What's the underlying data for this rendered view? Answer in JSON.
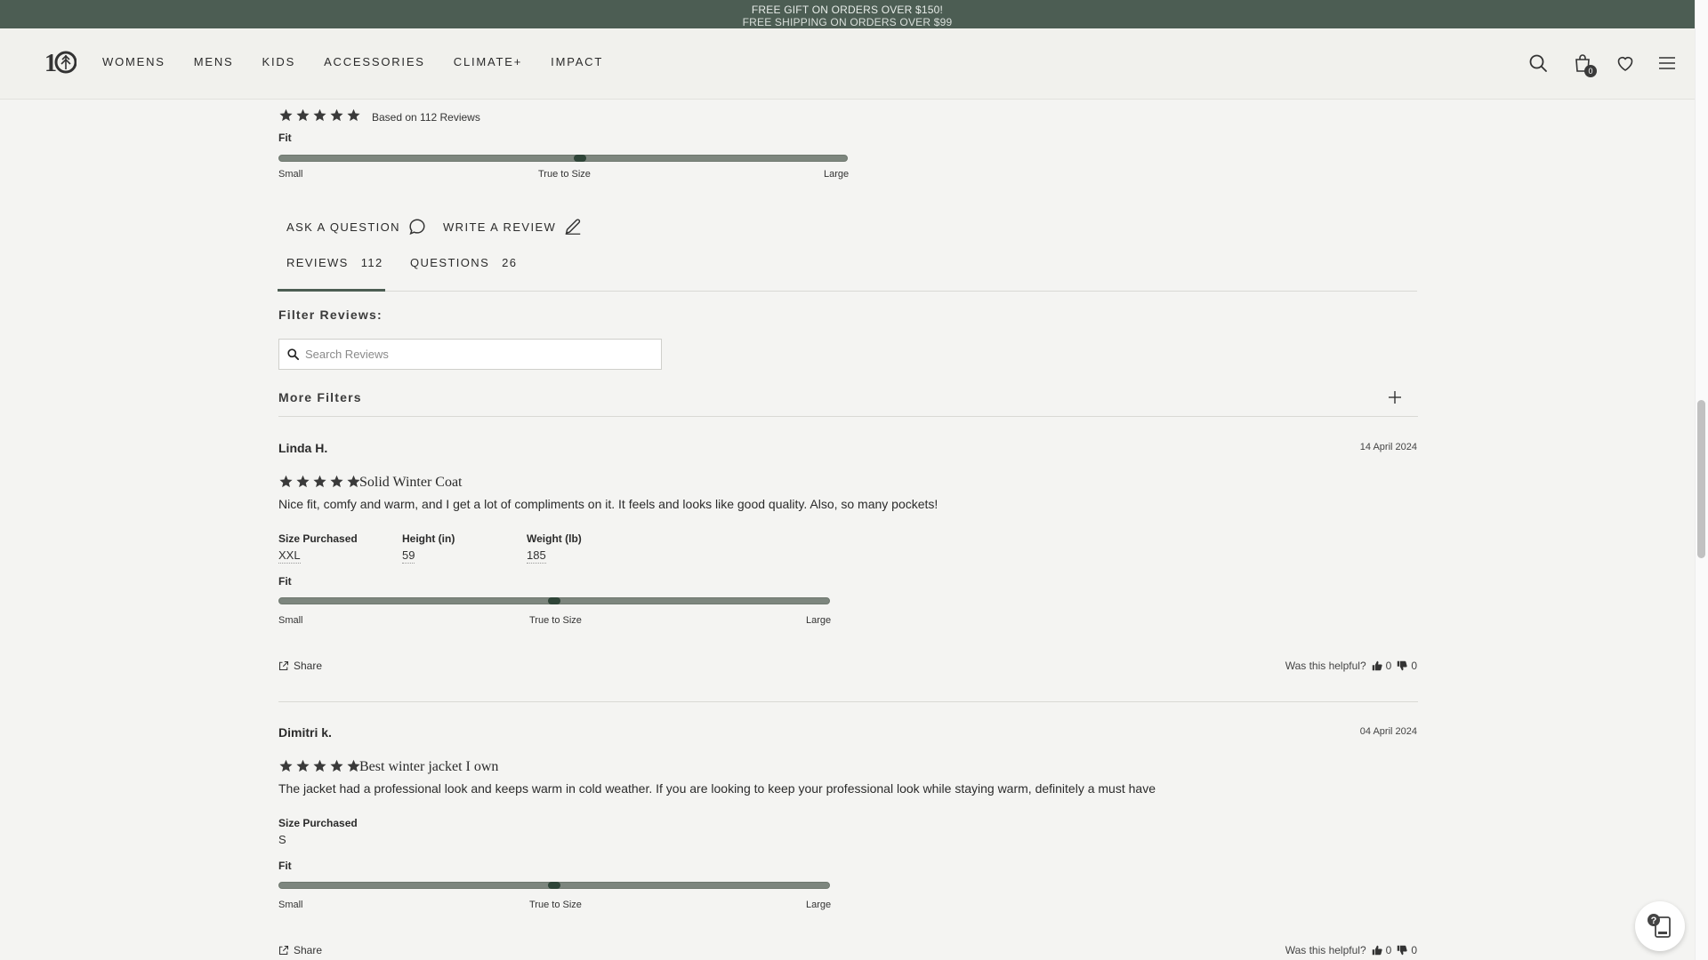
{
  "announcement": {
    "line1": "FREE GIFT ON ORDERS OVER $150!",
    "line2": "FREE SHIPPING ON ORDERS OVER $99"
  },
  "header": {
    "logo": "10-tree-logo",
    "nav": [
      "WOMENS",
      "MENS",
      "KIDS",
      "ACCESSORIES",
      "CLIMATE+",
      "IMPACT"
    ],
    "bag_count": "0",
    "icons": [
      "search-icon",
      "bag-icon",
      "heart-icon",
      "hamburger-menu-icon"
    ]
  },
  "summary": {
    "rating": 5,
    "based_on": "Based on 112 Reviews",
    "fit_label": "Fit",
    "fit_value": 0.53,
    "fit_min": "Small",
    "fit_mid": "True to Size",
    "fit_max": "Large"
  },
  "actions": {
    "ask": "ASK A QUESTION",
    "write": "WRITE A REVIEW"
  },
  "tabs": [
    {
      "label": "REVIEWS",
      "count": "112"
    },
    {
      "label": "QUESTIONS",
      "count": "26"
    }
  ],
  "filters": {
    "title": "Filter Reviews:",
    "search_placeholder": "Search Reviews",
    "more": "More Filters"
  },
  "reviews": [
    {
      "name": "Linda H.",
      "date": "14 April 2024",
      "rating": 5,
      "title": "Solid Winter Coat",
      "body": "Nice fit, comfy and warm, and I get a lot of compliments on it. It feels and looks like good quality. Also, so many pockets!",
      "attrs": [
        {
          "label": "Size Purchased",
          "value": "XXL"
        },
        {
          "label": "Height (in)",
          "value": "59"
        },
        {
          "label": "Weight (lb)",
          "value": "185"
        }
      ],
      "fit_label": "Fit",
      "fit_value": 0.5,
      "fit_min": "Small",
      "fit_mid": "True to Size",
      "fit_max": "Large",
      "share": "Share",
      "helpful": "Was this helpful?",
      "up": "0",
      "down": "0"
    },
    {
      "name": "Dimitri k.",
      "date": "04 April 2024",
      "rating": 5,
      "title": "Best winter jacket I own",
      "body": "The jacket had a professional look and keeps warm in cold weather. If you are looking to keep your professional look while staying warm, definitely a must have",
      "attrs": [
        {
          "label": "Size Purchased",
          "value": "S"
        }
      ],
      "fit_label": "Fit",
      "fit_value": 0.5,
      "fit_min": "Small",
      "fit_mid": "True to Size",
      "fit_max": "Large",
      "share": "Share",
      "helpful": "Was this helpful?",
      "up": "0",
      "down": "0"
    }
  ],
  "colors": {
    "announcement_bg": "#4c5d53",
    "fit_track": "#7d867e",
    "fit_marker": "#2f4538",
    "page_bg": "#f4f4f2"
  }
}
